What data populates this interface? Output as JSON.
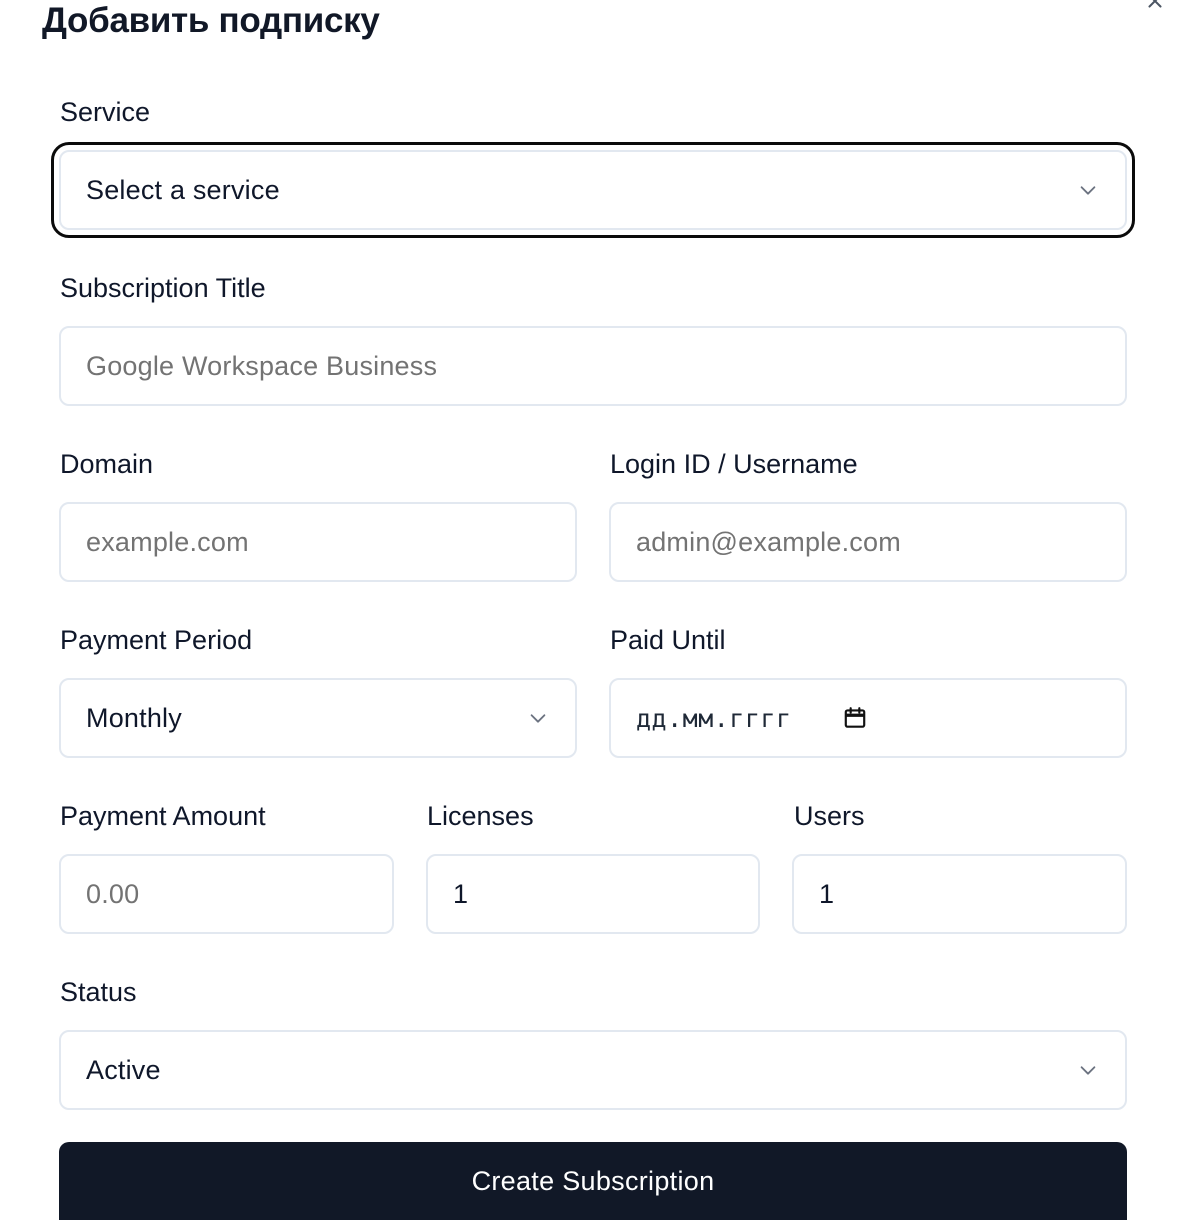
{
  "dialog": {
    "title": "Добавить подписку",
    "close_icon": "close-icon"
  },
  "form": {
    "service": {
      "label": "Service",
      "selected": "Select a service"
    },
    "subscription_title": {
      "label": "Subscription Title",
      "placeholder": "Google Workspace Business",
      "value": ""
    },
    "domain": {
      "label": "Domain",
      "placeholder": "example.com",
      "value": ""
    },
    "login": {
      "label": "Login ID / Username",
      "placeholder": "admin@example.com",
      "value": ""
    },
    "payment_period": {
      "label": "Payment Period",
      "selected": "Monthly"
    },
    "paid_until": {
      "label": "Paid Until",
      "display": "дд.мм.гггг",
      "icon": "calendar-icon"
    },
    "payment_amount": {
      "label": "Payment Amount",
      "placeholder": "0.00",
      "value": ""
    },
    "licenses": {
      "label": "Licenses",
      "value": "1"
    },
    "users": {
      "label": "Users",
      "value": "1"
    },
    "status": {
      "label": "Status",
      "selected": "Active"
    },
    "submit_label": "Create Subscription"
  },
  "colors": {
    "primary_button": "#111827",
    "border": "#e2e8f0",
    "focus_ring": "#0b0b0b",
    "placeholder": "#737373"
  }
}
